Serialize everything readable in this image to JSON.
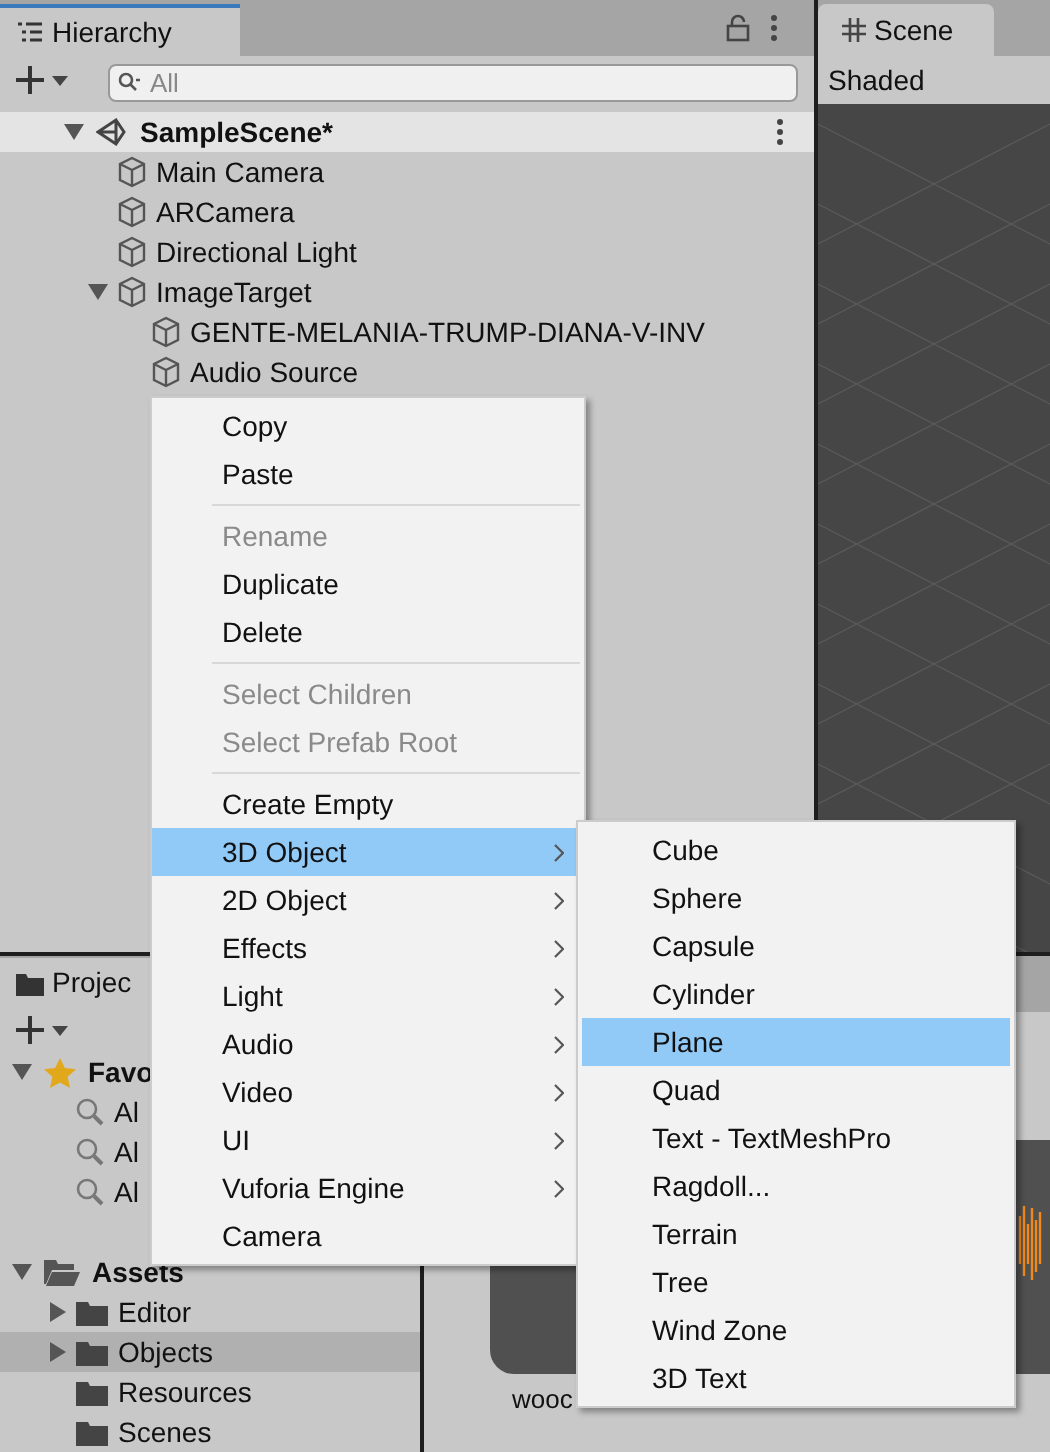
{
  "hierarchy": {
    "tab": "Hierarchy",
    "search": {
      "placeholder": "All"
    },
    "scene": {
      "name": "SampleScene*",
      "expanded": true,
      "children": [
        {
          "name": "Main Camera"
        },
        {
          "name": "ARCamera"
        },
        {
          "name": "Directional Light"
        },
        {
          "name": "ImageTarget",
          "expanded": true,
          "children": [
            {
              "name": "GENTE-MELANIA-TRUMP-DIANA-V-INV"
            },
            {
              "name": "Audio Source"
            }
          ]
        }
      ]
    }
  },
  "scene_view": {
    "tab": "Scene",
    "shading": "Shaded"
  },
  "project": {
    "tab": "Projec",
    "favorites": {
      "label": "Favo",
      "expanded": true,
      "items": [
        "Al",
        "Al",
        "Al"
      ]
    },
    "assets": {
      "label": "Assets",
      "expanded": true,
      "children": [
        {
          "name": "Editor",
          "has_children": true,
          "selected": false
        },
        {
          "name": "Objects",
          "has_children": true,
          "selected": true
        },
        {
          "name": "Resources",
          "has_children": false,
          "selected": false
        },
        {
          "name": "Scenes",
          "has_children": false,
          "selected": false
        }
      ]
    },
    "preview_label": "wooc"
  },
  "context_menu": {
    "items": [
      {
        "kind": "item",
        "label": "Copy",
        "disabled": false,
        "selected": false,
        "submenu": false
      },
      {
        "kind": "item",
        "label": "Paste",
        "disabled": false,
        "selected": false,
        "submenu": false
      },
      {
        "kind": "separator"
      },
      {
        "kind": "item",
        "label": "Rename",
        "disabled": true,
        "selected": false,
        "submenu": false
      },
      {
        "kind": "item",
        "label": "Duplicate",
        "disabled": false,
        "selected": false,
        "submenu": false
      },
      {
        "kind": "item",
        "label": "Delete",
        "disabled": false,
        "selected": false,
        "submenu": false
      },
      {
        "kind": "separator"
      },
      {
        "kind": "item",
        "label": "Select Children",
        "disabled": true,
        "selected": false,
        "submenu": false
      },
      {
        "kind": "item",
        "label": "Select Prefab Root",
        "disabled": true,
        "selected": false,
        "submenu": false
      },
      {
        "kind": "separator"
      },
      {
        "kind": "item",
        "label": "Create Empty",
        "disabled": false,
        "selected": false,
        "submenu": false
      },
      {
        "kind": "item",
        "label": "3D Object",
        "disabled": false,
        "selected": true,
        "submenu": true
      },
      {
        "kind": "item",
        "label": "2D Object",
        "disabled": false,
        "selected": false,
        "submenu": true
      },
      {
        "kind": "item",
        "label": "Effects",
        "disabled": false,
        "selected": false,
        "submenu": true
      },
      {
        "kind": "item",
        "label": "Light",
        "disabled": false,
        "selected": false,
        "submenu": true
      },
      {
        "kind": "item",
        "label": "Audio",
        "disabled": false,
        "selected": false,
        "submenu": true
      },
      {
        "kind": "item",
        "label": "Video",
        "disabled": false,
        "selected": false,
        "submenu": true
      },
      {
        "kind": "item",
        "label": "UI",
        "disabled": false,
        "selected": false,
        "submenu": true
      },
      {
        "kind": "item",
        "label": "Vuforia Engine",
        "disabled": false,
        "selected": false,
        "submenu": true
      },
      {
        "kind": "item",
        "label": "Camera",
        "disabled": false,
        "selected": false,
        "submenu": false
      }
    ]
  },
  "submenu": {
    "items": [
      {
        "label": "Cube",
        "selected": false
      },
      {
        "label": "Sphere",
        "selected": false
      },
      {
        "label": "Capsule",
        "selected": false
      },
      {
        "label": "Cylinder",
        "selected": false
      },
      {
        "label": "Plane",
        "selected": true
      },
      {
        "label": "Quad",
        "selected": false
      },
      {
        "label": "Text - TextMeshPro",
        "selected": false
      },
      {
        "label": "Ragdoll...",
        "selected": false
      },
      {
        "label": "Terrain",
        "selected": false
      },
      {
        "label": "Tree",
        "selected": false
      },
      {
        "label": "Wind Zone",
        "selected": false
      },
      {
        "label": "3D Text",
        "selected": false
      }
    ]
  }
}
